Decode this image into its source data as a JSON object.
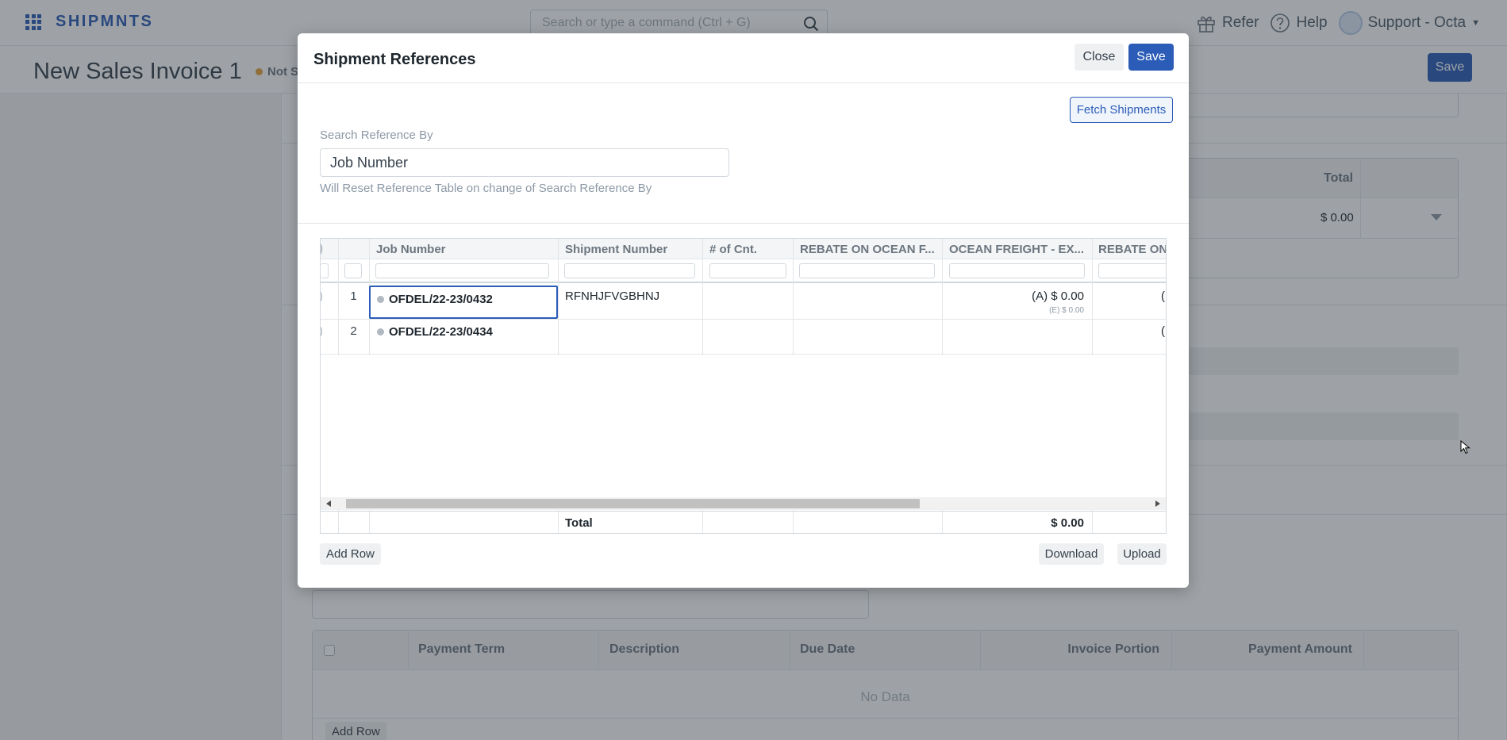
{
  "navbar": {
    "brand": "SHIPMNTS",
    "search_placeholder": "Search or type a command (Ctrl + G)",
    "refer": "Refer",
    "help": "Help",
    "user": "Support - Octa"
  },
  "page": {
    "title": "New Sales Invoice 1",
    "status": "Not Saved",
    "save_label": "Save"
  },
  "background": {
    "total_header": "Total",
    "total_value": "$ 0.00",
    "payment_table": {
      "columns": [
        "Payment Term",
        "Description",
        "Due Date",
        "Invoice Portion",
        "Payment Amount"
      ],
      "empty": "No Data",
      "add_row": "Add Row"
    }
  },
  "modal": {
    "title": "Shipment References",
    "close_label": "Close",
    "save_label": "Save",
    "fetch_label": "Fetch Shipments",
    "search_label": "Search Reference By",
    "search_value": "Job Number",
    "search_help": "Will Reset Reference Table on change of Search Reference By",
    "grid": {
      "columns": [
        "Job Number",
        "Shipment Number",
        "# of Cnt.",
        "REBATE ON OCEAN F...",
        "OCEAN FREIGHT - EX...",
        "REBATE ON"
      ],
      "rows": [
        {
          "num": "1",
          "job": "OFDEL/22-23/0432",
          "shipment": "RFNHJFVGBHNJ",
          "cnt": "",
          "rebate": "",
          "ocean_a": "(A) $ 0.00",
          "ocean_e": "(E) $ 0.00",
          "rebate2": "("
        },
        {
          "num": "2",
          "job": "OFDEL/22-23/0434",
          "shipment": "",
          "cnt": "",
          "rebate": "",
          "ocean_a": "",
          "ocean_e": "",
          "rebate2": "("
        }
      ],
      "total_label": "Total",
      "total_value": "$ 0.00"
    },
    "add_row_label": "Add Row",
    "download_label": "Download",
    "upload_label": "Upload"
  }
}
